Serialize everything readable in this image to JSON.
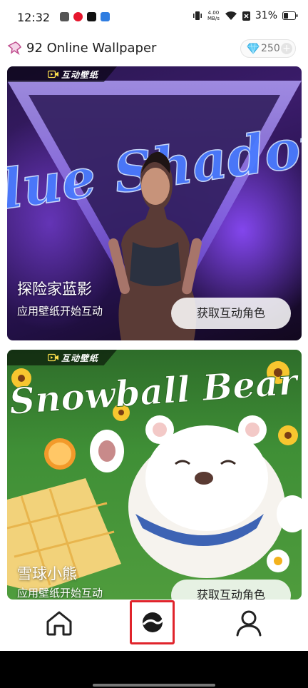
{
  "status_bar": {
    "time": "12:32",
    "speed_value": "4.00",
    "speed_unit": "MB/s",
    "battery": "31%"
  },
  "header": {
    "title": "92 Online Wallpaper",
    "gems": "250",
    "add_symbol": "+"
  },
  "cards": [
    {
      "tag": "互动壁纸",
      "art_text": "Blue Shadow",
      "title": "探险家蓝影",
      "subtitle": "应用壁纸开始互动",
      "button": "获取互动角色"
    },
    {
      "tag": "互动壁纸",
      "art_text": "Snowball Bear",
      "title": "雪球小熊",
      "subtitle": "应用壁纸开始互动",
      "button": "获取互动角色"
    }
  ],
  "nav": {
    "items": [
      "home-icon",
      "discover-icon",
      "profile-icon"
    ],
    "active": "discover-icon",
    "highlight_color": "#e0242b"
  },
  "colors": {
    "accent": "#e0242b",
    "gem": "#4fc3f7"
  }
}
